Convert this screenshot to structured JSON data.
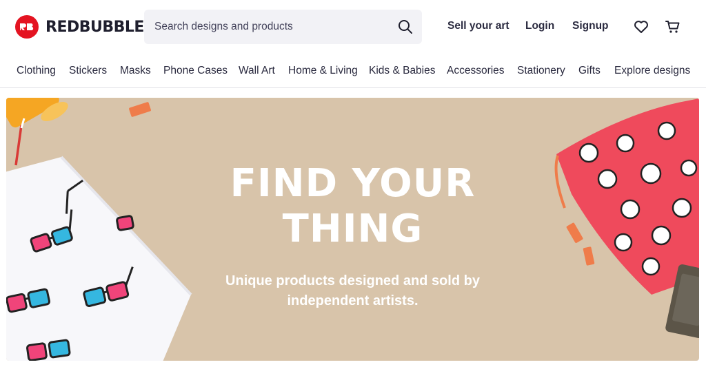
{
  "brand": {
    "name": "REDBUBBLE",
    "color": "#e41321"
  },
  "search": {
    "placeholder": "Search designs and products"
  },
  "header": {
    "sell": "Sell your art",
    "login": "Login",
    "signup": "Signup"
  },
  "nav": [
    "Clothing",
    "Stickers",
    "Masks",
    "Phone Cases",
    "Wall Art",
    "Home & Living",
    "Kids & Babies",
    "Accessories",
    "Stationery",
    "Gifts",
    "Explore designs"
  ],
  "hero": {
    "title_line1": "FIND YOUR",
    "title_line2": "THING",
    "subtitle_line1": "Unique products designed and sold by",
    "subtitle_line2": "independent artists.",
    "background": "#d8c4aa"
  },
  "icons": [
    "logo-mark",
    "search-icon",
    "heart-icon",
    "cart-icon"
  ]
}
